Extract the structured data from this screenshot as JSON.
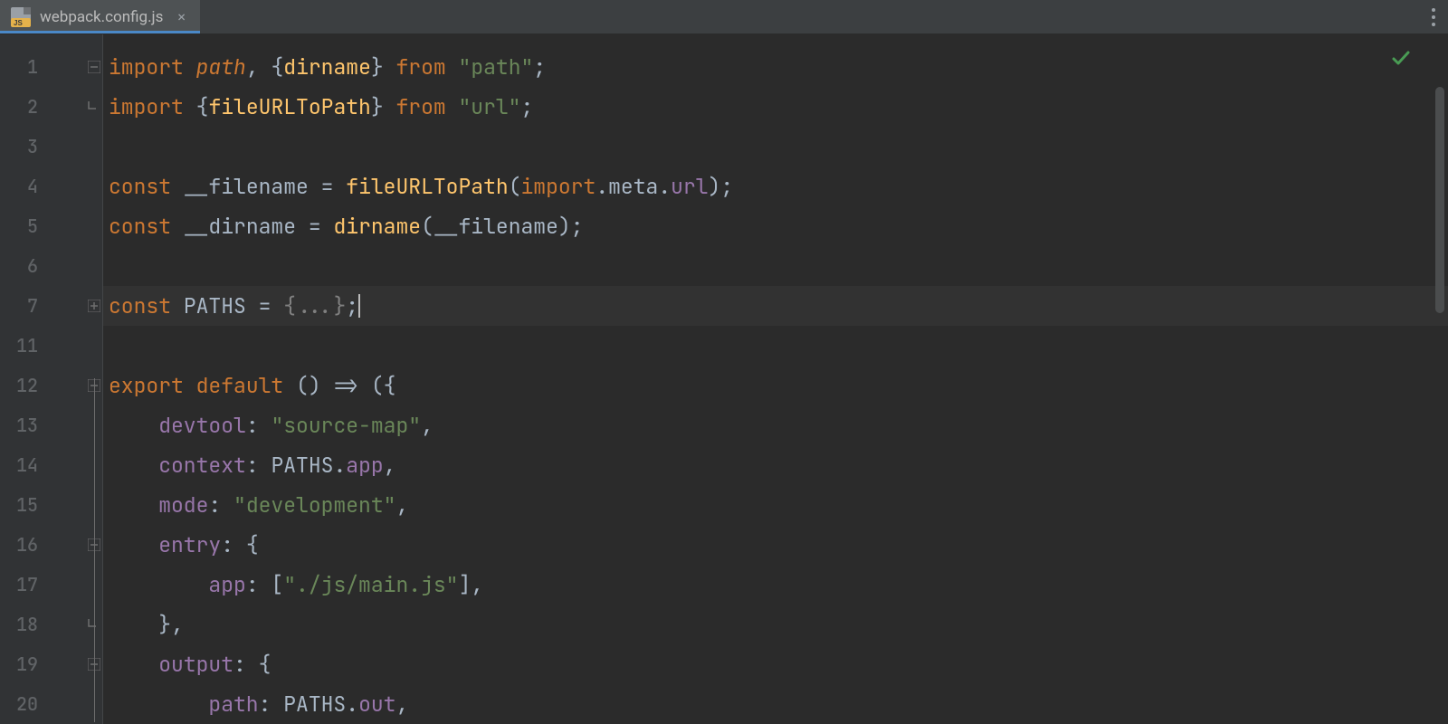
{
  "tab": {
    "filename": "webpack.config.js",
    "close_glyph": "×"
  },
  "colors": {
    "status_ok": "#499c54"
  },
  "gutter_numbers": [
    "1",
    "2",
    "3",
    "4",
    "5",
    "6",
    "7",
    "11",
    "12",
    "13",
    "14",
    "15",
    "16",
    "17",
    "18",
    "19",
    "20"
  ],
  "code": {
    "l1": {
      "import": "import",
      "path": "path",
      "comma": ",",
      "lb": "{",
      "dirname": "dirname",
      "rb": "}",
      "from": "from",
      "str": "\"path\"",
      "semi": ";"
    },
    "l2": {
      "import": "import",
      "lb": "{",
      "fileURLToPath": "fileURLToPath",
      "rb": "}",
      "from": "from",
      "str": "\"url\"",
      "semi": ";"
    },
    "l4": {
      "const": "const",
      "name": "__filename",
      "eq": "=",
      "fn": "fileURLToPath",
      "lp": "(",
      "import": "import",
      "dot1": ".",
      "meta": "meta",
      "dot2": ".",
      "url": "url",
      "rp": ")",
      "semi": ";"
    },
    "l5": {
      "const": "const",
      "name": "__dirname",
      "eq": "=",
      "fn": "dirname",
      "lp": "(",
      "arg": "__filename",
      "rp": ")",
      "semi": ";"
    },
    "l7": {
      "const": "const",
      "name": "PATHS",
      "eq": "=",
      "fold": "{...}",
      "semi": ";"
    },
    "l12": {
      "export": "export",
      "default": "default",
      "arrow": "() => ({"
    },
    "l13": {
      "key": "devtool",
      "colon": ":",
      "val": "\"source-map\"",
      "comma": ","
    },
    "l14": {
      "key": "context",
      "colon": ":",
      "obj": "PATHS",
      "dot": ".",
      "member": "app",
      "comma": ","
    },
    "l15": {
      "key": "mode",
      "colon": ":",
      "val": "\"development\"",
      "comma": ","
    },
    "l16": {
      "key": "entry",
      "colon": ":",
      "brace": "{"
    },
    "l17": {
      "key": "app",
      "colon": ":",
      "lbracket": "[",
      "val": "\"./js/main.js\"",
      "rbracket": "]",
      "comma": ","
    },
    "l18": {
      "brace": "}",
      "comma": ","
    },
    "l19": {
      "key": "output",
      "colon": ":",
      "brace": "{"
    },
    "l20": {
      "key": "path",
      "colon": ":",
      "obj": "PATHS",
      "dot": ".",
      "member": "out",
      "comma": ","
    }
  }
}
